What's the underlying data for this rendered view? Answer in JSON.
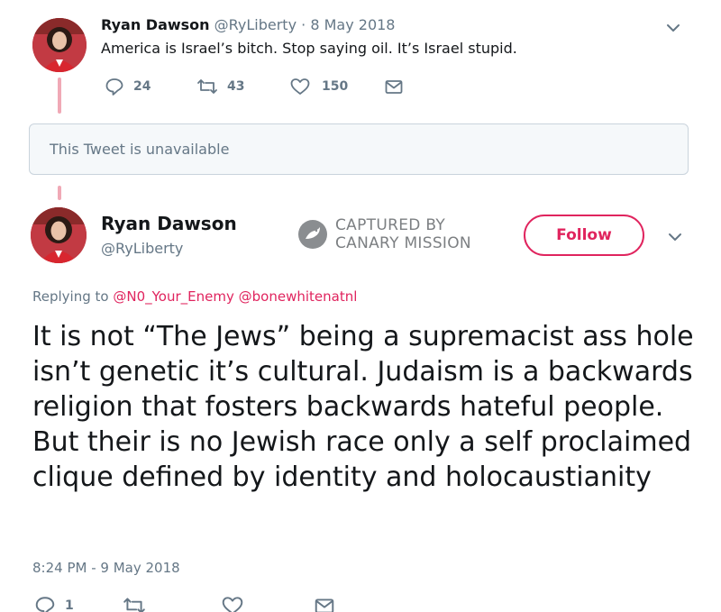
{
  "tweet1": {
    "name": "Ryan Dawson",
    "handle": "@RyLiberty",
    "separator": "·",
    "date": "8 May 2018",
    "text": "America is Israel’s bitch. Stop saying oil. It’s Israel stupid.",
    "actions": {
      "replies": "24",
      "retweets": "43",
      "likes": "150"
    }
  },
  "unavailable": {
    "text": "This Tweet is unavailable"
  },
  "tweet2": {
    "name": "Ryan Dawson",
    "handle": "@RyLiberty",
    "watermark": {
      "line1": "CAPTURED BY",
      "line2": "CANARY MISSION"
    },
    "follow_label": "Follow",
    "replying_prefix": "Replying to",
    "mentions": [
      "@N0_Your_Enemy",
      "@bonewhitenatnl"
    ],
    "text": "It is not “The Jews” being a supremacist ass hole isn’t genetic it’s cultural. Judaism is a backwards religion that fosters backwards hateful people. But their is no Jewish race only a self proclaimed clique defined by identity and holocaustianity",
    "timestamp": "8:24 PM - 9 May 2018",
    "actions": {
      "replies": "1"
    }
  },
  "colors": {
    "accent": "#e0245e",
    "muted": "#657786",
    "thread_line": "#f0a9b6",
    "text": "#14171a"
  },
  "icons": [
    "reply-icon",
    "retweet-icon",
    "like-icon",
    "dm-icon",
    "chevron-down-icon",
    "canary-logo-icon"
  ]
}
